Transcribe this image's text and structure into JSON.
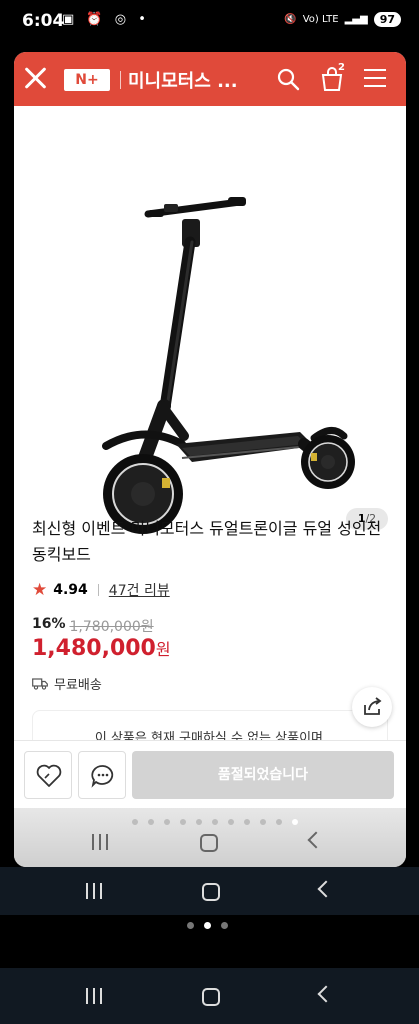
{
  "status_bar": {
    "time": "6:04",
    "icons_left": "▣ ⏰ ◎ •",
    "signal": "Vo) LTE",
    "battery": "97"
  },
  "header": {
    "logo": "N+",
    "title": "미니모터스 ...",
    "cart_count": "2"
  },
  "image": {
    "current": "1",
    "total": "/2",
    "subject": "electric-scooter"
  },
  "product": {
    "title": "최신형 이벤트 미니모터스 듀얼트론이글 듀얼 성인전동킥보드",
    "rating": "4.94",
    "reviews": "47건 리뷰",
    "discount_rate": "16%",
    "original_price": "1,780,000원",
    "price": "1,480,000",
    "price_unit": "원",
    "shipping": "무료배송"
  },
  "notice": "이 상품은 현재 구매하실 수 없는 상품이며,",
  "actions": {
    "soldout": "품절되었습니다"
  },
  "colors": {
    "brand": "#e04a3a",
    "price": "#d0202e"
  }
}
